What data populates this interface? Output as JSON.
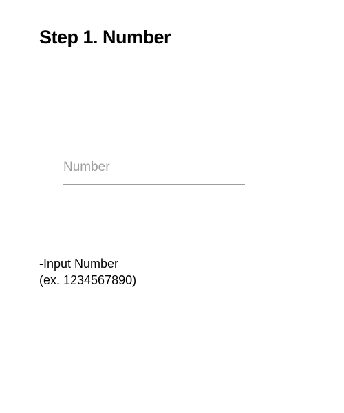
{
  "page": {
    "title": "Step 1. Number"
  },
  "number_field": {
    "placeholder": "Number",
    "value": ""
  },
  "instructions": {
    "line1": "-Input Number",
    "line2": "(ex. 1234567890)"
  },
  "colors": {
    "text": "#000000",
    "placeholder": "#9e9e9e",
    "underline": "#9e9e9e",
    "background": "#ffffff"
  }
}
